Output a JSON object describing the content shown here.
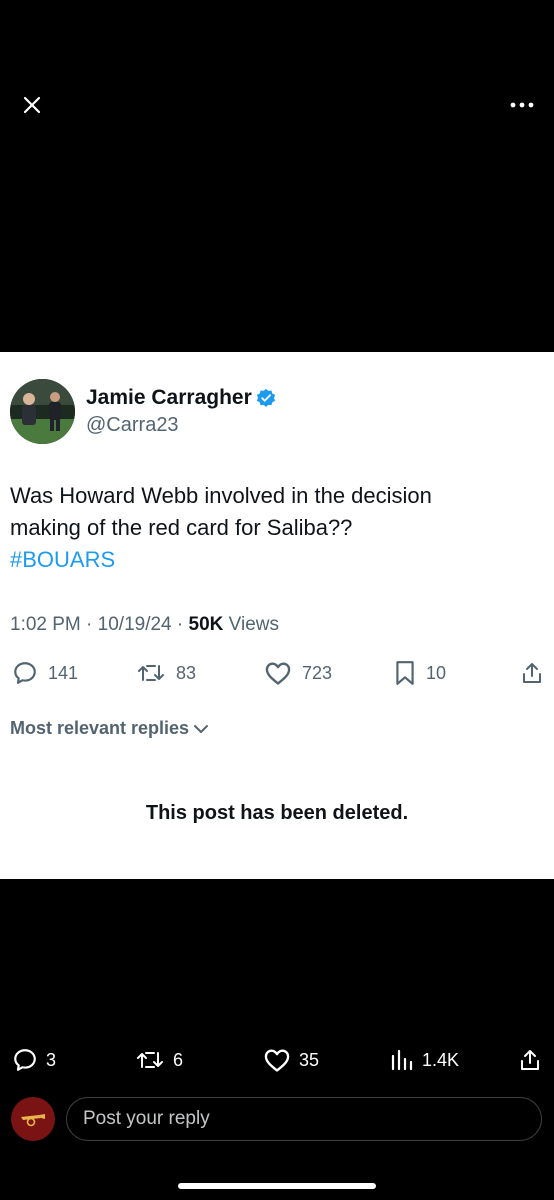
{
  "header": {
    "close_icon": "close-icon",
    "more_icon": "more-horizontal-icon"
  },
  "tweet": {
    "author_name": "Jamie Carragher",
    "author_handle": "@Carra23",
    "verified_icon": "verified-badge-icon",
    "text_lines": [
      "Was Howard Webb involved in the decision",
      "making of the red card for Saliba??"
    ],
    "hashtag": "#BOUARS",
    "time": "1:02 PM",
    "separator": "·",
    "date": "10/19/24",
    "views_count": "50K",
    "views_label": "Views",
    "actions": {
      "replies": "141",
      "reposts": "83",
      "likes": "723",
      "bookmarks": "10"
    }
  },
  "replies_filter": {
    "label": "Most relevant replies"
  },
  "deleted_notice": "This post has been deleted.",
  "bottom_bar": {
    "replies": "3",
    "reposts": "6",
    "likes": "35",
    "views": "1.4K"
  },
  "composer": {
    "placeholder": "Post your reply"
  },
  "colors": {
    "accent": "#1d9bf0",
    "text_primary": "#0f1419",
    "text_secondary": "#536471",
    "background_dark": "#000000",
    "card_background": "#ffffff"
  }
}
